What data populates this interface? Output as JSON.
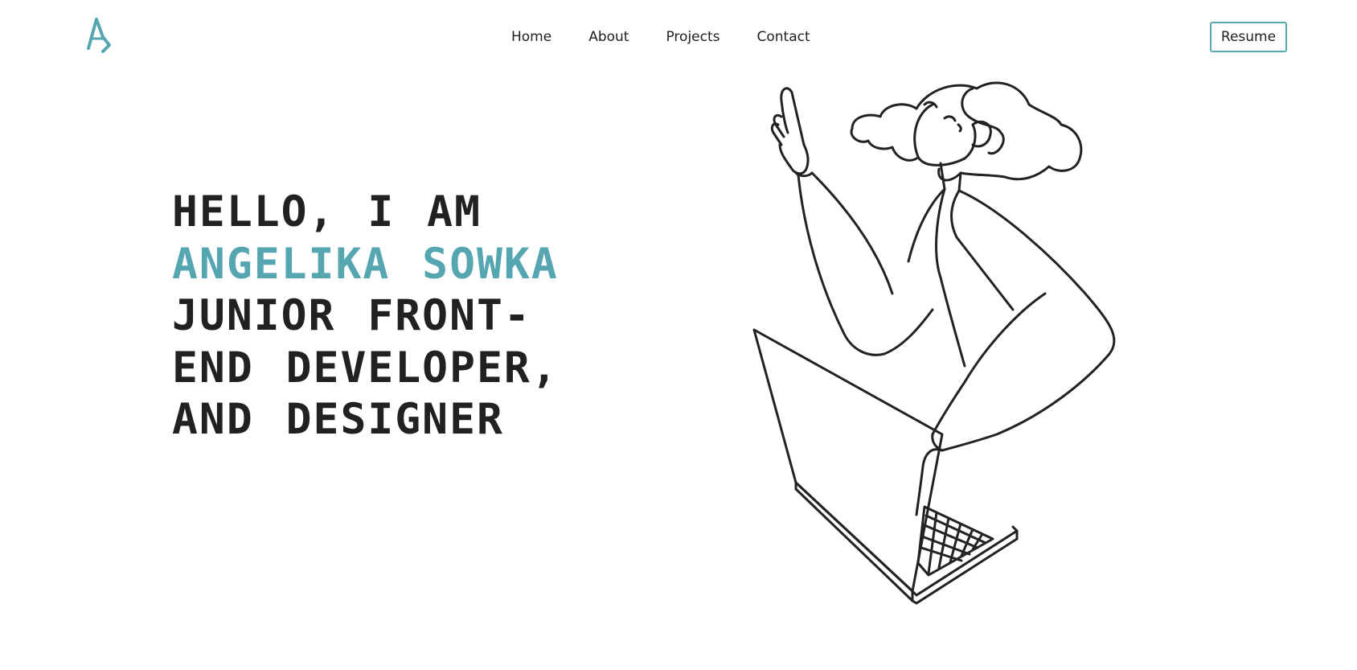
{
  "header": {
    "logo_icon": "monogram-logo-icon",
    "nav": [
      {
        "label": "Home"
      },
      {
        "label": "About"
      },
      {
        "label": "Projects"
      },
      {
        "label": "Contact"
      }
    ],
    "resume_label": "Resume"
  },
  "hero": {
    "line1": "HELLO, I AM",
    "line2": "ANGELIKA SOWKA",
    "line3": "JUNIOR FRONT-",
    "line4": "END DEVELOPER,",
    "line5": "AND DESIGNER",
    "illustration_icon": "woman-with-laptop-illustration-icon"
  },
  "colors": {
    "accent": "#55a6b0",
    "text": "#212121",
    "background": "#ffffff"
  }
}
